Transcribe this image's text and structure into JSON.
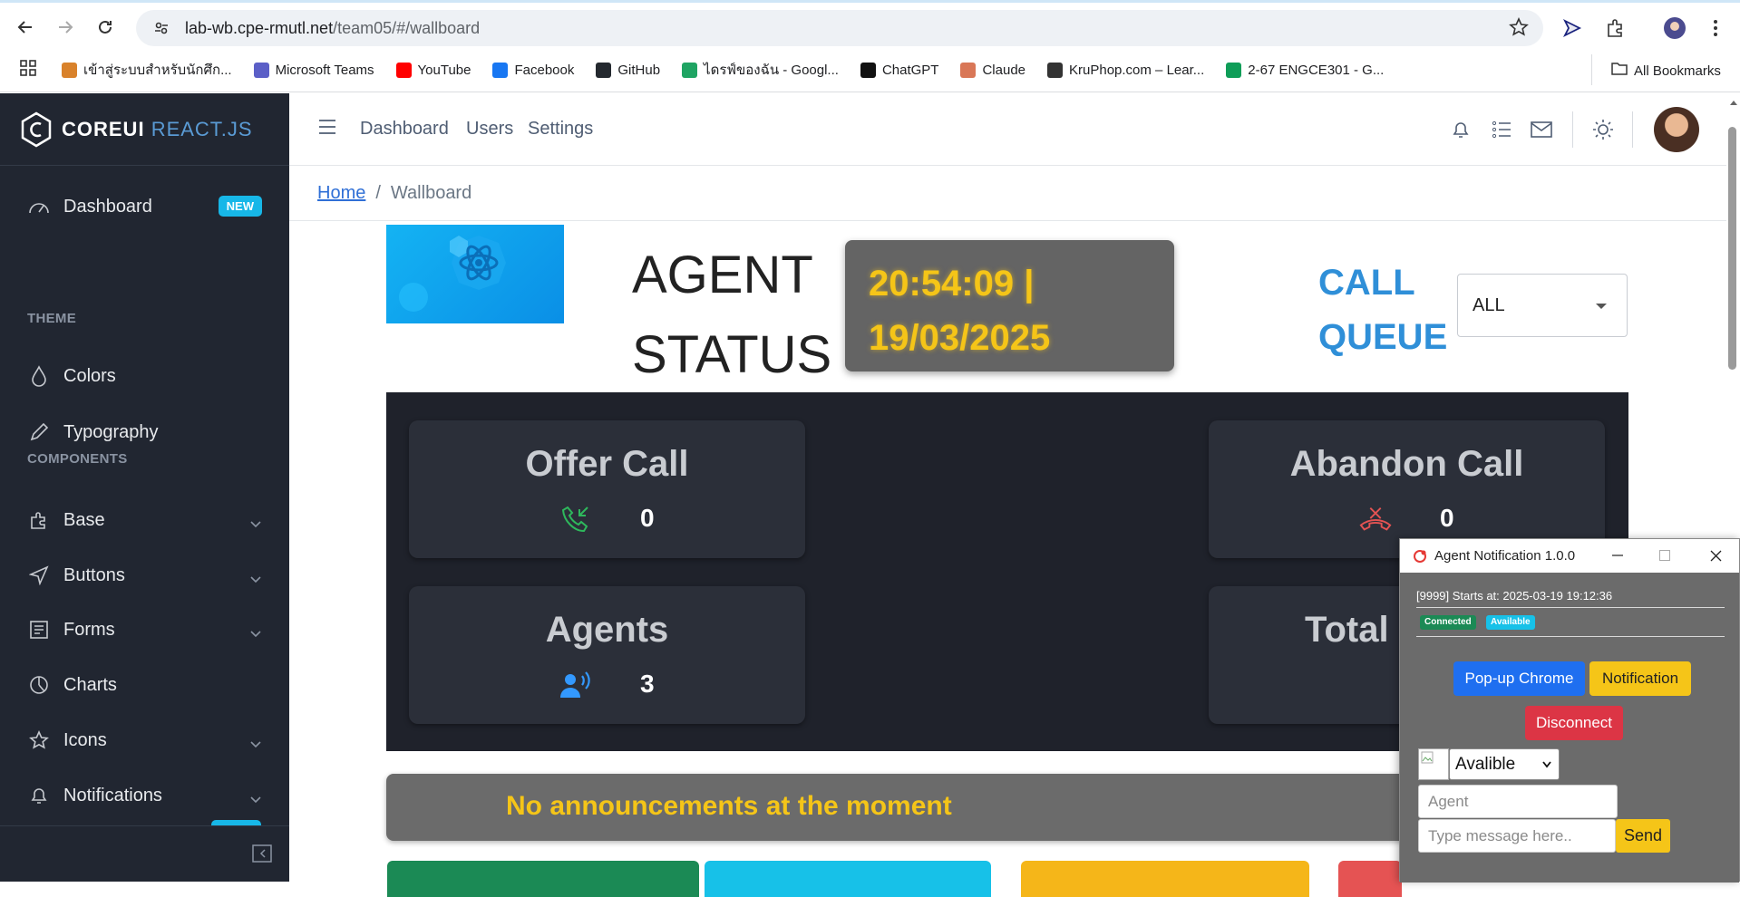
{
  "browser": {
    "url_host": "lab-wb.cpe-rmutl.net",
    "url_path": "/team05/#/wallboard",
    "bookmarks": [
      {
        "label": "เข้าสู่ระบบสำหรับนักศึก...",
        "icon": "candle-icon",
        "color": "#d9822b"
      },
      {
        "label": "Microsoft Teams",
        "icon": "teams-icon",
        "color": "#5b5fc7"
      },
      {
        "label": "YouTube",
        "icon": "youtube-icon",
        "color": "#ff0000"
      },
      {
        "label": "Facebook",
        "icon": "facebook-icon",
        "color": "#1877f2"
      },
      {
        "label": "GitHub",
        "icon": "github-icon",
        "color": "#24292f"
      },
      {
        "label": "ไดรฟ์ของฉัน - Googl...",
        "icon": "drive-icon",
        "color": "#1fa463"
      },
      {
        "label": "ChatGPT",
        "icon": "chatgpt-icon",
        "color": "#111111"
      },
      {
        "label": "Claude",
        "icon": "claude-icon",
        "color": "#d97757"
      },
      {
        "label": "KruPhop.com – Lear...",
        "icon": "kruphop-icon",
        "color": "#333333"
      },
      {
        "label": "2-67 ENGCE301 - G...",
        "icon": "sheets-icon",
        "color": "#0f9d58"
      }
    ],
    "all_bookmarks": "All Bookmarks"
  },
  "sidebar": {
    "brand_bold": "COREUI",
    "brand_light": "REACT.JS",
    "dashboard": "Dashboard",
    "dashboard_badge": "NEW",
    "theme_title": "THEME",
    "colors": "Colors",
    "typography": "Typography",
    "components_title": "COMPONENTS",
    "base": "Base",
    "buttons": "Buttons",
    "forms": "Forms",
    "charts": "Charts",
    "icons": "Icons",
    "notifications": "Notifications"
  },
  "header": {
    "nav": [
      "Dashboard",
      "Users",
      "Settings"
    ]
  },
  "breadcrumb": {
    "home": "Home",
    "separator": "/",
    "current": "Wallboard"
  },
  "wallboard": {
    "title_line1": "AGENT",
    "title_line2": "STATUS",
    "clock_time": "20:54:09 |",
    "clock_date": "19/03/2025",
    "call_queue_line1": "CALL",
    "call_queue_line2": "QUEUE",
    "queue_selected": "ALL",
    "cards": {
      "offer_call": {
        "title": "Offer Call",
        "value": "0"
      },
      "abandon_call": {
        "title": "Abandon Call",
        "value": "0"
      },
      "agents": {
        "title": "Agents",
        "value": "3"
      },
      "total": {
        "title": "Total"
      }
    },
    "announcement": "No announcements at the moment",
    "colors": {
      "clock_text": "#f5c518",
      "queue_label": "#2f8fd8",
      "offer_icon": "#2eb85c",
      "abandon_icon": "#e55353",
      "agents_icon": "#3399ff"
    }
  },
  "notification_window": {
    "title": "Agent Notification 1.0.0",
    "starts_at": "[9999] Starts at: 2025-03-19 19:12:36",
    "badge_connected": "Connected",
    "badge_available": "Available",
    "btn_popup": "Pop-up Chrome",
    "btn_notification": "Notification",
    "btn_disconnect": "Disconnect",
    "status_selected": "Avalible",
    "agent_placeholder": "Agent",
    "message_placeholder": "Type message here..",
    "btn_send": "Send"
  }
}
